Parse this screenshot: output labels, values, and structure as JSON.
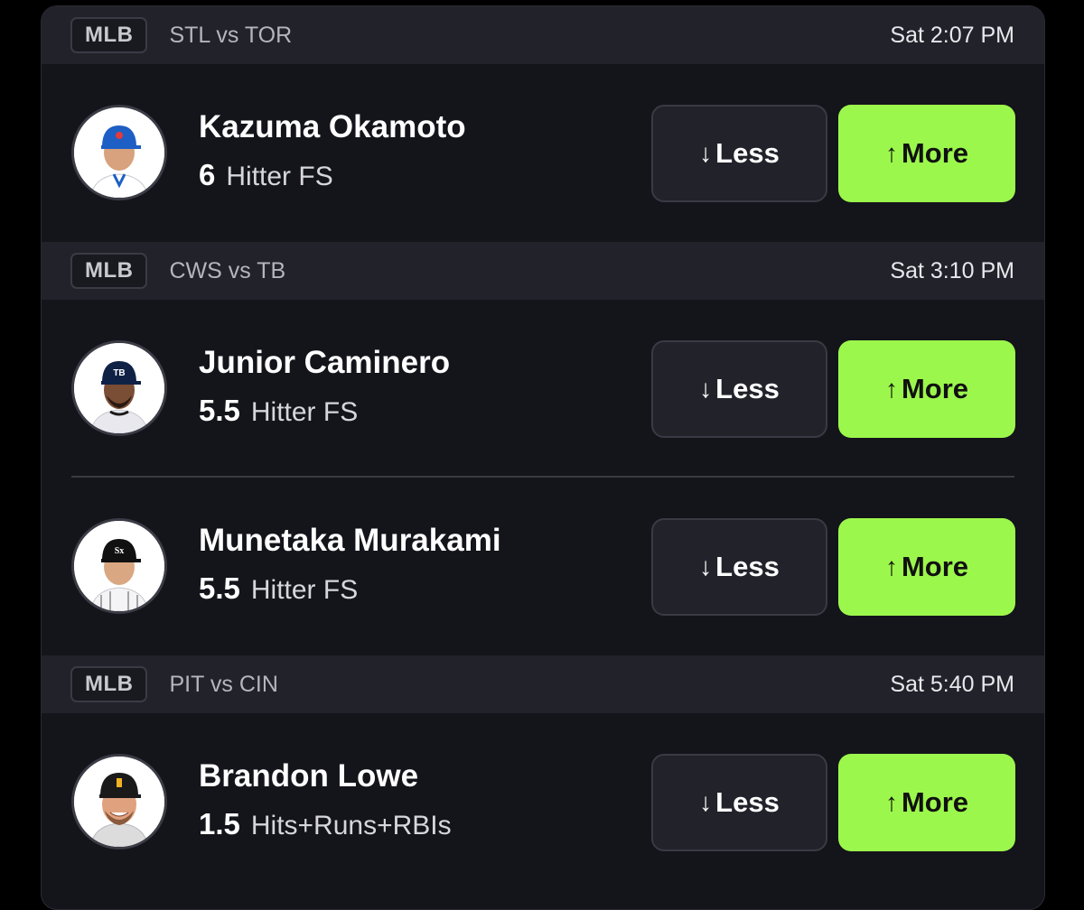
{
  "games": [
    {
      "league": "MLB",
      "matchup": "STL vs TOR",
      "time": "Sat 2:07 PM",
      "players": [
        {
          "name": "Kazuma Okamoto",
          "line": "6",
          "stat": "Hitter FS",
          "team_color": "#1d5fc4",
          "jersey_color": "#ffffff",
          "skin": "#d7a27d"
        }
      ]
    },
    {
      "league": "MLB",
      "matchup": "CWS vs TB",
      "time": "Sat 3:10 PM",
      "players": [
        {
          "name": "Junior Caminero",
          "line": "5.5",
          "stat": "Hitter FS",
          "team_color": "#0f2246",
          "jersey_color": "#e8e8ee",
          "skin": "#7a4d35"
        },
        {
          "name": "Munetaka Murakami",
          "line": "5.5",
          "stat": "Hitter FS",
          "team_color": "#111111",
          "jersey_color": "#f4f4f6",
          "skin": "#d9a883"
        }
      ]
    },
    {
      "league": "MLB",
      "matchup": "PIT vs CIN",
      "time": "Sat 5:40 PM",
      "players": [
        {
          "name": "Brandon Lowe",
          "line": "1.5",
          "stat": "Hits+Runs+RBIs",
          "team_color": "#1a1a1a",
          "jersey_color": "#dcdcdc",
          "skin": "#e0a17f"
        }
      ]
    }
  ],
  "buttons": {
    "less_label": "Less",
    "more_label": "More",
    "less_icon": "arrow-down-icon",
    "more_icon": "arrow-up-icon",
    "more_color": "#9cf74c"
  }
}
